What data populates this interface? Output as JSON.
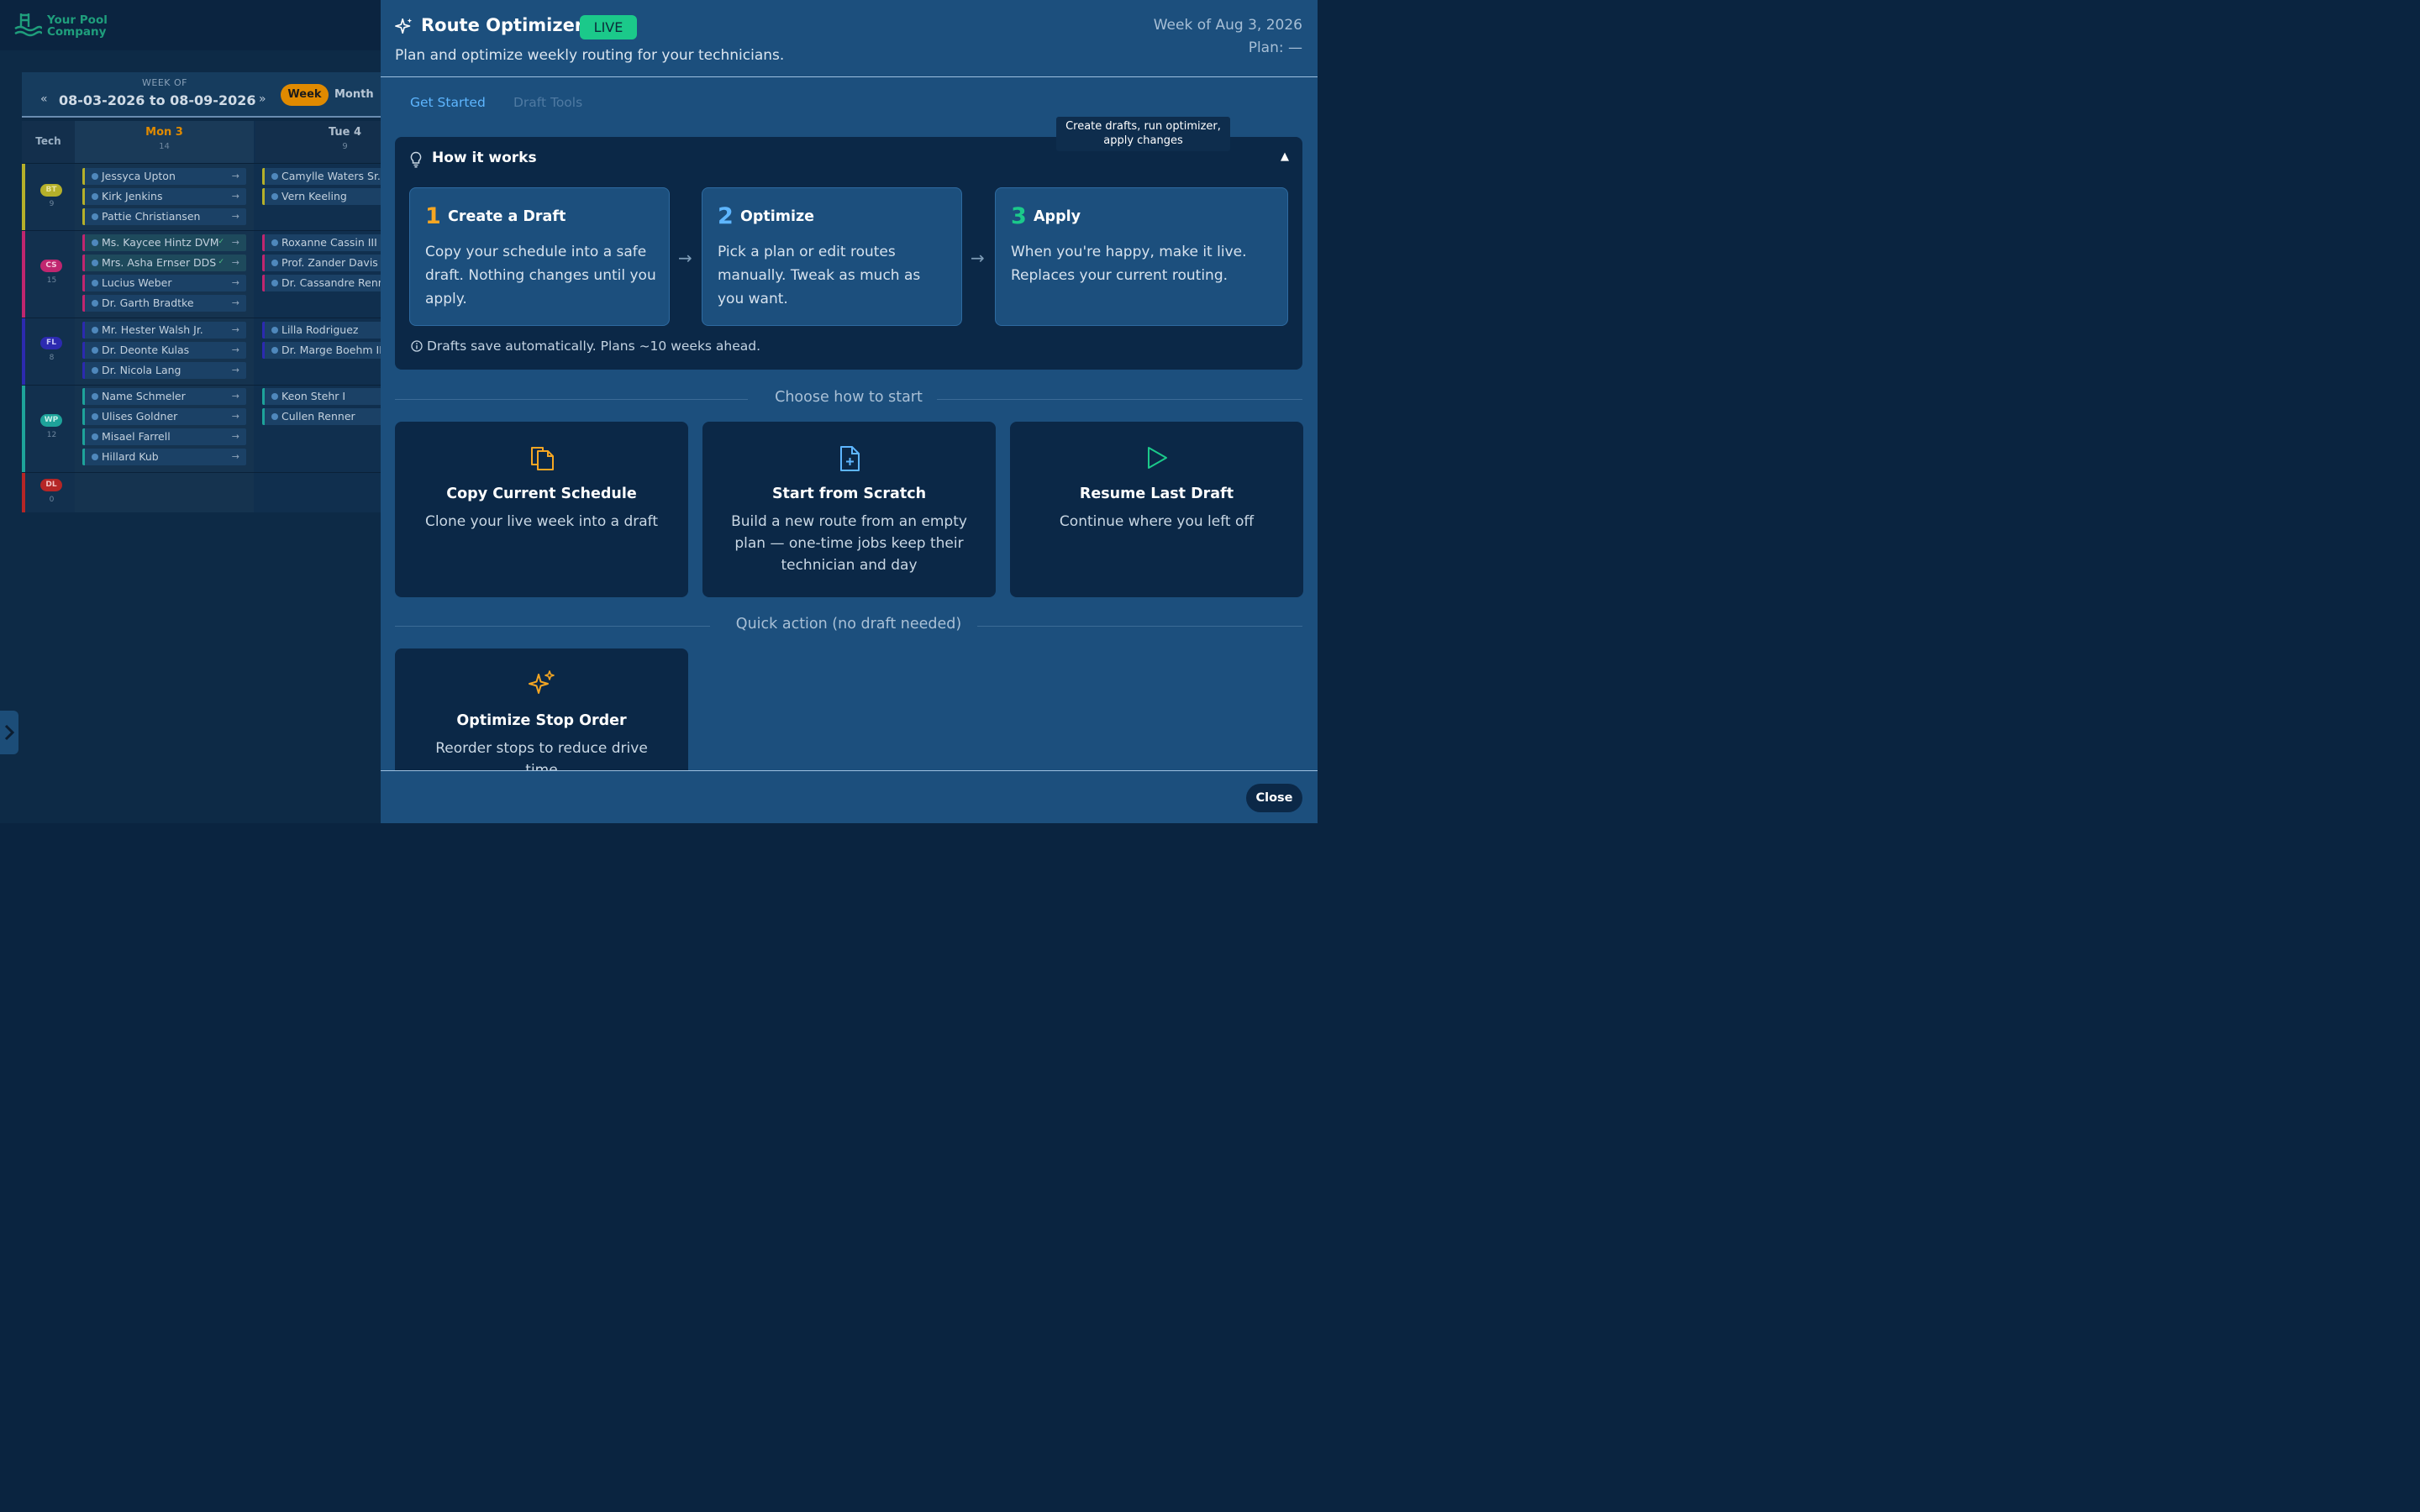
{
  "app": {
    "logo_text": "Your Pool Company",
    "colors": {
      "accent": "#e08a00",
      "live": "#1bc98a",
      "link": "#5eb6ff",
      "panel": "#1c4f7d",
      "card": "#0b2847"
    }
  },
  "scheduler": {
    "week_of_label": "WEEK OF",
    "week_range": "08-03-2026 to 08-09-2026",
    "prev_icon": "«",
    "next_icon": "»",
    "view_week": "Week",
    "view_month": "Month",
    "tech_header": "Tech",
    "days": [
      {
        "name": "Mon 3",
        "count": "14"
      },
      {
        "name": "Tue 4",
        "count": "9"
      }
    ],
    "techs": [
      {
        "initials": "BT",
        "count": "9",
        "color": "#b5b02a",
        "mon": [
          "Jessyca Upton",
          "Kirk Jenkins",
          "Pattie Christiansen"
        ],
        "tue": [
          "Camylle Waters Sr.",
          "Vern Keeling"
        ]
      },
      {
        "initials": "CS",
        "count": "15",
        "color": "#c0266f",
        "mon": [
          "Ms. Kaycee Hintz DVM",
          "Mrs. Asha Ernser DDS",
          "Lucius Weber",
          "Dr. Garth Bradtke"
        ],
        "tue": [
          "Roxanne Cassin III",
          "Prof. Zander Davis M",
          "Dr. Cassandre Renn"
        ]
      },
      {
        "initials": "FL",
        "count": "8",
        "color": "#2c2ab0",
        "mon": [
          "Mr. Hester Walsh Jr.",
          "Dr. Deonte Kulas",
          "Dr. Nicola Lang"
        ],
        "tue": [
          "Lilla Rodriguez",
          "Dr. Marge Boehm II"
        ]
      },
      {
        "initials": "WP",
        "count": "12",
        "color": "#1ea39a",
        "mon": [
          "Name Schmeler",
          "Ulises Goldner",
          "Misael Farrell",
          "Hillard Kub"
        ],
        "tue": [
          "Keon Stehr I",
          "Cullen Renner"
        ]
      },
      {
        "initials": "DL",
        "count": "0",
        "color": "#b52626",
        "mon": [],
        "tue": []
      }
    ]
  },
  "panel": {
    "title": "Route Optimizer",
    "status_badge": "LIVE",
    "subtitle": "Plan and optimize weekly routing for your technicians.",
    "week_of": "Week of Aug 3, 2026",
    "plan": "Plan: —",
    "tabs": [
      {
        "label": "Get Started",
        "active": true
      },
      {
        "label": "Draft Tools",
        "active": false
      }
    ],
    "tooltip": "Create drafts, run optimizer, apply changes",
    "how_it_works": {
      "title": "How it works",
      "collapse_icon": "▲",
      "steps": [
        {
          "num": "1",
          "title": "Create a Draft",
          "text": "Copy your schedule into a safe draft. Nothing changes until you apply.",
          "color": "#f5a623"
        },
        {
          "num": "2",
          "title": "Optimize",
          "text": "Pick a plan or edit routes manually. Tweak as much as you want.",
          "color": "#5eb6ff"
        },
        {
          "num": "3",
          "title": "Apply",
          "text": "When you're happy, make it live. Replaces your current routing.",
          "color": "#1bc98a"
        }
      ],
      "step_arrow": "→",
      "note": "Drafts save automatically. Plans ~10 weeks ahead."
    },
    "choose_label": "Choose how to start",
    "start_options": [
      {
        "title": "Copy Current Schedule",
        "desc": "Clone your live week into a draft",
        "icon": "copy-icon",
        "icon_color": "#f5a623"
      },
      {
        "title": "Start from Scratch",
        "desc": "Build a new route from an empty plan — one-time jobs keep their technician and day",
        "icon": "file-plus-icon",
        "icon_color": "#5eb6ff"
      },
      {
        "title": "Resume Last Draft",
        "desc": "Continue where you left off",
        "icon": "play-icon",
        "icon_color": "#1bc98a"
      }
    ],
    "quick_label": "Quick action (no draft needed)",
    "quick_action": {
      "title": "Optimize Stop Order",
      "desc": "Reorder stops to reduce drive time",
      "icon": "sparkles-icon",
      "icon_color": "#f5a623"
    },
    "close_label": "Close"
  }
}
